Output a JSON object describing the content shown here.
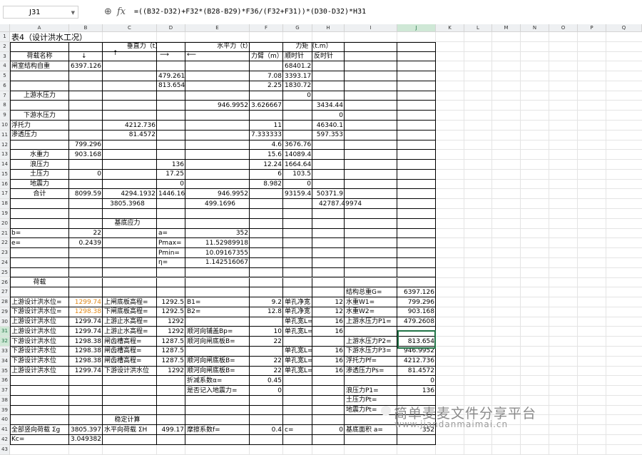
{
  "formula_bar": {
    "name_box": "J31",
    "fx": "fx",
    "formula": "=((B32-D32)+F32*(B28-B29)*F36/(F32+F31))*(D30-D32)*H31"
  },
  "columns": [
    "A",
    "B",
    "C",
    "D",
    "E",
    "F",
    "G",
    "H",
    "I",
    "J",
    "K",
    "L",
    "M",
    "N",
    "O",
    "P",
    "Q"
  ],
  "rows": [
    "1",
    "2",
    "3",
    "4",
    "5",
    "6",
    "7",
    "8",
    "9",
    "10",
    "11",
    "12",
    "13",
    "14",
    "15",
    "16",
    "17",
    "18",
    "19",
    "20",
    "21",
    "22",
    "23",
    "24",
    "25",
    "26",
    "27",
    "28",
    "29",
    "30",
    "31",
    "32",
    "33",
    "34",
    "35",
    "36",
    "37",
    "38",
    "39",
    "40",
    "41",
    "42",
    "43"
  ],
  "cells": {
    "A1": "表4（设计洪水工况）",
    "C2": "垂直力（t）",
    "E2": "水平力（t）",
    "G2": "力矩（t.m）",
    "A3": "荷载名称",
    "F3": "力臂（m）",
    "G3": "顺时针",
    "H3": "反时针",
    "A4": "闸室结构自重",
    "B4": "6397.126",
    "G4": "68401.2",
    "D5": "479.261",
    "F5": "7.08",
    "G5": "3393.17",
    "D6": "813.654",
    "F6": "2.25",
    "G6": "1830.72",
    "A7": "上游水压力",
    "G7": "0",
    "E8": "946.9952",
    "F8": "3.626667",
    "H8": "3434.44",
    "A9": "下游水压力",
    "H9": "0",
    "A10": "浮托力",
    "C10": "4212.736",
    "F10": "11",
    "H10": "46340.1",
    "A11": "渗透压力",
    "C11": "81.4572",
    "F11": "7.333333",
    "H11": "597.353",
    "B12": "799.296",
    "F12": "4.6",
    "G12": "3676.76",
    "A13": "水重力",
    "B13": "903.168",
    "F13": "15.6",
    "G13": "14089.4",
    "A14": "浪压力",
    "D14": "136",
    "F14": "12.24",
    "G14": "1664.64",
    "A15": "土压力",
    "B15": "0",
    "D15": "17.25",
    "F15": "6",
    "G15": "103.5",
    "A16": "地震力",
    "D16": "0",
    "F16": "8.982",
    "G16": "0",
    "A17": "合计",
    "B17": "8099.59",
    "C17": "4294.1932",
    "D17": "1446.16",
    "E17": "946.9952",
    "G17": "93159.4",
    "H17": "50371.9",
    "B18": "3805.3968",
    "D18": "499.1696",
    "G18": "42787.49974",
    "B20": "基底应力",
    "A21": "b=",
    "B21": "22",
    "D21": "a=",
    "E21": "352",
    "A22": "e=",
    "B22": "0.2439",
    "D22": "Pmax=",
    "E22": "11.52989918",
    "D23": "Pmin=",
    "E23": "10.09167355",
    "D24": "η=",
    "E24": "1.142516067",
    "A26": "荷载",
    "I27": "结构总重G=",
    "J27": "6397.126",
    "A28": "上游设计洪水位=",
    "B28": "1299.74",
    "C28": "上闸底板高程=",
    "D28": "1292.5",
    "E28": "B1=",
    "F28": "9.2",
    "G28": "单孔净宽",
    "H28": "12",
    "I28": "水重W1=",
    "J28": "799.296",
    "A29": "下游设计洪水位=",
    "B29": "1298.38",
    "C29": "下闸底板高程=",
    "D29": "1292.5",
    "E29": "B2=",
    "F29": "12.8",
    "G29": "单孔净宽",
    "H29": "12",
    "I29": "水重W2=",
    "J29": "903.168",
    "A30": "上游设计洪水位",
    "B30": "1299.74",
    "C30": "上游止水高程=",
    "D30": "1292",
    "G30": "单孔宽L=",
    "H30": "16",
    "I30": "上游水压力P1=",
    "J30": "479.2608",
    "A31": "上游设计洪水位",
    "B31": "1299.74",
    "C31": "上游止水高程=",
    "D31": "1292",
    "E31": "顺河向铺盖Bp=",
    "F31": "10",
    "G31": "单孔宽L=",
    "H31": "16",
    "A32": "下游设计洪水位",
    "B32": "1298.38",
    "C32": "闸齿槽高程=",
    "D32": "1287.5",
    "E32": "顺河向闸底板B=",
    "F32": "22",
    "I32": "上游水压力P2=",
    "J32": "813.654",
    "A33": "下游设计洪水位",
    "B33": "1298.38",
    "C33": "闸齿槽高程=",
    "D33": "1287.5",
    "G33": "单孔宽L=",
    "H33": "16",
    "I33": "下游水压力P3=",
    "J33": "946.9952",
    "A34": "下游设计洪水位",
    "B34": "1298.38",
    "C34": "闸齿槽高程=",
    "D34": "1287.5",
    "E34": "顺河向闸底板B=",
    "F34": "22",
    "G34": "单孔宽L=",
    "H34": "16",
    "I34": "浮托力Pf=",
    "J34": "4212.736",
    "A35": "上游设计洪水位",
    "B35": "1299.74",
    "C35": "下游设计洪水位",
    "D35": "1292",
    "E35": "顺河向闸底板B=",
    "F35": "22",
    "G35": "单孔宽L=",
    "H35": "16",
    "I35": "渗透压力Ps=",
    "J35": "81.4572",
    "E36": "折减系数α=",
    "F36": "0.45",
    "J36": "0",
    "E37": "是否记入地震力=",
    "F37": "0",
    "I37": "浪压力P1=",
    "J37": "136",
    "I38": "土压力Pt=",
    "I39": "地震力Pt=",
    "B40": "稳定计算",
    "A41": "全部竖向荷载 Σg",
    "B41": "3805.397",
    "C41": "水平向荷载 ΣH",
    "D41": "499.17",
    "E41": "摩擦系数f=",
    "F41": "0.4",
    "G41": "c=",
    "H41": "0",
    "I41": "基底面积 a=",
    "J41": "352",
    "A42": "Kc=",
    "B42": "3.049382"
  },
  "watermark": {
    "line1": "简单麦麦文件分享平台",
    "line2": "www.jiandanmaimai.cn"
  },
  "colors": {
    "selection": "#217346",
    "orange_text": "#e08a1c"
  }
}
